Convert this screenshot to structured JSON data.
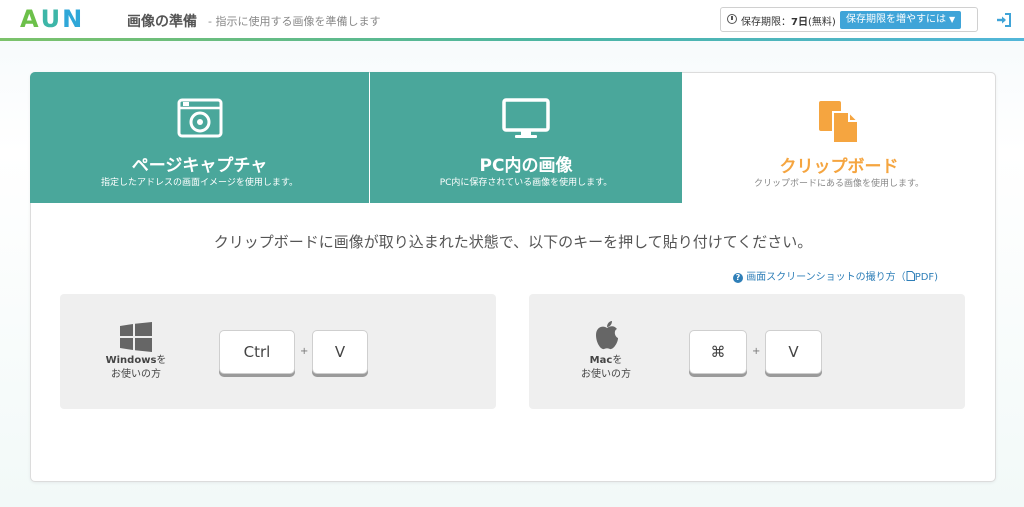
{
  "header": {
    "logo": [
      "A",
      "U",
      "N"
    ],
    "title": "画像の準備",
    "subtitle": "- 指示に使用する画像を準備します",
    "expiry_label": "保存期限：",
    "expiry_value": "7日",
    "expiry_note": "(無料)",
    "extend_button": "保存期限を増やすには"
  },
  "tabs": [
    {
      "icon": "camera-icon",
      "title": "ページキャプチャ",
      "desc": "指定したアドレスの画面イメージを使用します。",
      "active": false
    },
    {
      "icon": "monitor-icon",
      "title": "PC内の画像",
      "desc": "PC内に保存されている画像を使用します。",
      "active": false
    },
    {
      "icon": "clipboard-icon",
      "title": "クリップボード",
      "desc": "クリップボードにある画像を使用します。",
      "active": true
    }
  ],
  "instruction": "クリップボードに画像が取り込まれた状態で、以下のキーを押して貼り付けてください。",
  "help_link": "画面スクリーンショットの撮り方（",
  "help_link_pdf": "PDF)",
  "windows": {
    "os_name": "Windows",
    "suffix": "を",
    "line2": "お使いの方",
    "key1": "Ctrl",
    "plus": "+",
    "key2": "V"
  },
  "mac": {
    "os_name": "Mac",
    "suffix": "を",
    "line2": "お使いの方",
    "key1": "⌘",
    "plus": "+",
    "key2": "V"
  },
  "colors": {
    "teal": "#4aa79b",
    "active": "#f5a540",
    "accent_blue": "#3fa4d8"
  }
}
